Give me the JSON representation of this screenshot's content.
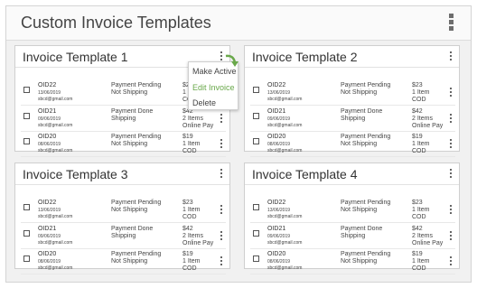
{
  "app": {
    "title": "Custom Invoice Templates"
  },
  "menu": {
    "options": [
      "Make Active",
      "Edit Invoice",
      "Delete"
    ],
    "highlight_color": "#69a84a"
  },
  "templates": [
    {
      "title": "Invoice Template 1",
      "rows": [
        {
          "oid": "OID22",
          "date": "13/06/2019",
          "email": "sbcd@gmail.com",
          "payment": "Payment Pending",
          "shipping": "Not Shipping",
          "price": "$23",
          "items": "1 Item",
          "method": "COD"
        },
        {
          "oid": "OID21",
          "date": "09/06/2019",
          "email": "sbcd@gmail.com",
          "payment": "Payment Done",
          "shipping": "Shipping",
          "price": "$42",
          "items": "2 Items",
          "method": "Online Pay"
        },
        {
          "oid": "OID20",
          "date": "08/06/2019",
          "email": "sbcd@gmail.com",
          "payment": "Payment Pending",
          "shipping": "Not Shipping",
          "price": "$19",
          "items": "1 Item",
          "method": "COD"
        }
      ]
    },
    {
      "title": "Invoice Template 2",
      "rows": [
        {
          "oid": "OID22",
          "date": "13/06/2019",
          "email": "sbcd@gmail.com",
          "payment": "Payment Pending",
          "shipping": "Not Shipping",
          "price": "$23",
          "items": "1 Item",
          "method": "COD"
        },
        {
          "oid": "OID21",
          "date": "09/06/2019",
          "email": "sbcd@gmail.com",
          "payment": "Payment Done",
          "shipping": "Shipping",
          "price": "$42",
          "items": "2 Items",
          "method": "Online Pay"
        },
        {
          "oid": "OID20",
          "date": "08/06/2019",
          "email": "sbcd@gmail.com",
          "payment": "Payment Pending",
          "shipping": "Not Shipping",
          "price": "$19",
          "items": "1 Item",
          "method": "COD"
        }
      ]
    },
    {
      "title": "Invoice Template 3",
      "rows": [
        {
          "oid": "OID22",
          "date": "13/06/2019",
          "email": "sbcd@gmail.com",
          "payment": "Payment Pending",
          "shipping": "Not Shipping",
          "price": "$23",
          "items": "1 Item",
          "method": "COD"
        },
        {
          "oid": "OID21",
          "date": "09/06/2019",
          "email": "sbcd@gmail.com",
          "payment": "Payment Done",
          "shipping": "Shipping",
          "price": "$42",
          "items": "2 Items",
          "method": "Online Pay"
        },
        {
          "oid": "OID20",
          "date": "08/06/2019",
          "email": "sbcd@gmail.com",
          "payment": "Payment Pending",
          "shipping": "Not Shipping",
          "price": "$19",
          "items": "1 Item",
          "method": "COD"
        }
      ]
    },
    {
      "title": "Invoice Template 4",
      "rows": [
        {
          "oid": "OID22",
          "date": "13/06/2019",
          "email": "sbcd@gmail.com",
          "payment": "Payment Pending",
          "shipping": "Not Shipping",
          "price": "$23",
          "items": "1 Item",
          "method": "COD"
        },
        {
          "oid": "OID21",
          "date": "09/06/2019",
          "email": "sbcd@gmail.com",
          "payment": "Payment Done",
          "shipping": "Shipping",
          "price": "$42",
          "items": "2 Items",
          "method": "Online Pay"
        },
        {
          "oid": "OID20",
          "date": "08/06/2019",
          "email": "sbcd@gmail.com",
          "payment": "Payment Pending",
          "shipping": "Not Shipping",
          "price": "$19",
          "items": "1 Item",
          "method": "COD"
        }
      ]
    }
  ]
}
